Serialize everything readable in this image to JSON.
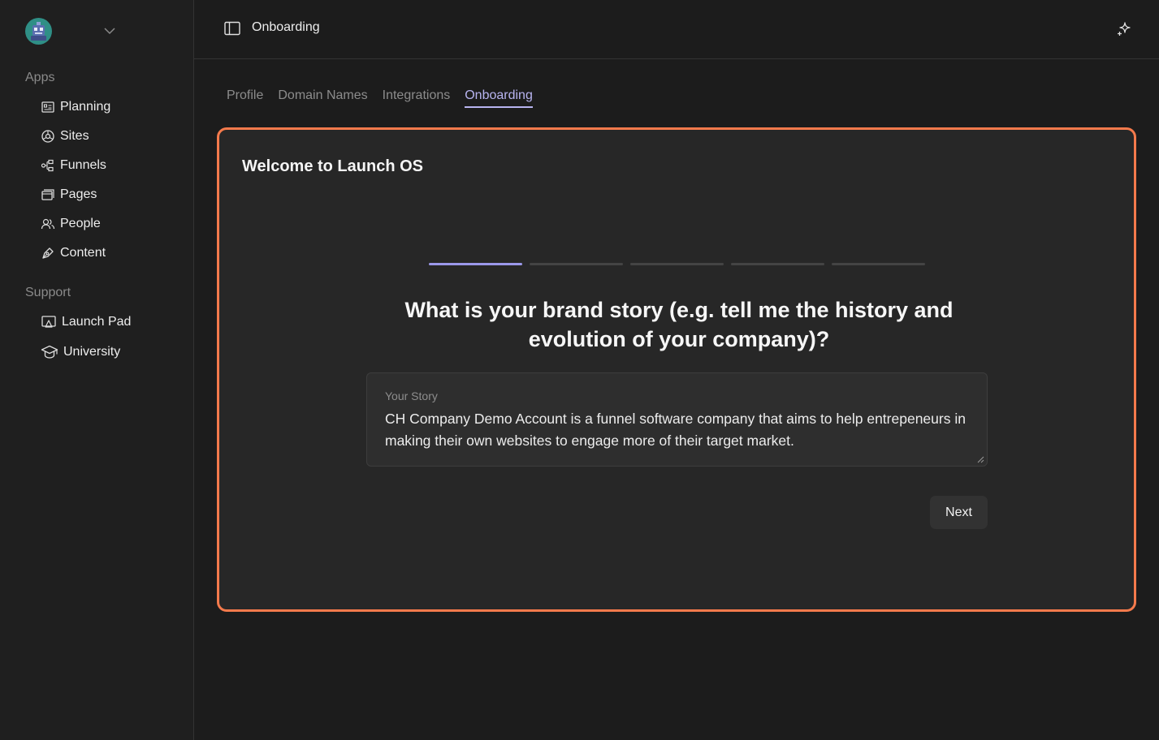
{
  "sidebar": {
    "apps_label": "Apps",
    "apps": [
      {
        "label": "Planning",
        "icon": "planning-icon"
      },
      {
        "label": "Sites",
        "icon": "sites-icon"
      },
      {
        "label": "Funnels",
        "icon": "funnels-icon"
      },
      {
        "label": "Pages",
        "icon": "pages-icon"
      },
      {
        "label": "People",
        "icon": "people-icon"
      },
      {
        "label": "Content",
        "icon": "content-icon"
      }
    ],
    "support_label": "Support",
    "support": [
      {
        "label": "Launch Pad",
        "icon": "launch-pad-icon"
      },
      {
        "label": "University",
        "icon": "university-icon"
      }
    ]
  },
  "header": {
    "title": "Onboarding"
  },
  "tabs": [
    {
      "label": "Profile",
      "active": false
    },
    {
      "label": "Domain Names",
      "active": false
    },
    {
      "label": "Integrations",
      "active": false
    },
    {
      "label": "Onboarding",
      "active": true
    }
  ],
  "onboarding": {
    "card_title": "Welcome to Launch OS",
    "total_steps": 5,
    "current_step": 1,
    "question_line1": "What is your brand story (e.g. tell me the history and",
    "question_line2": "evolution of your company)?",
    "field_label": "Your Story",
    "field_value": "CH Company Demo Account is a funnel software company that aims to help entrepeneurs in making their own websites to engage more of their target market.",
    "next_label": "Next"
  },
  "colors": {
    "accent": "#b8b4f0",
    "card_border": "#f47a4c",
    "background": "#1c1c1c"
  }
}
